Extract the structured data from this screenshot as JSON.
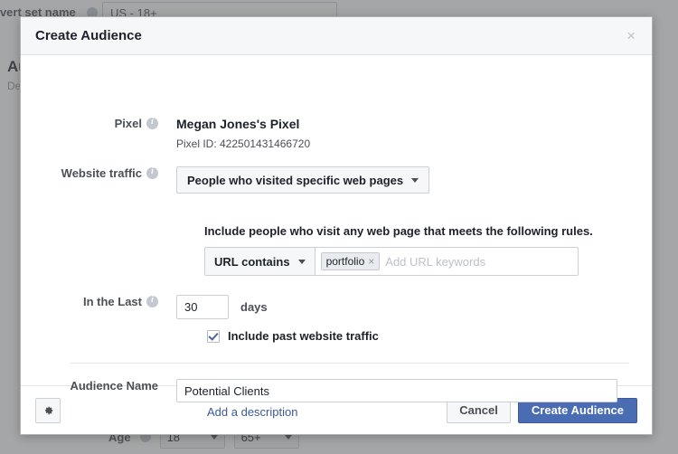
{
  "background": {
    "advert_set_label": "dvert set name",
    "advert_set_value": "US - 18+",
    "section_heading": "Au",
    "section_sub": "De",
    "age_label": "Age",
    "age_min": "18",
    "age_max": "65+"
  },
  "modal": {
    "title": "Create Audience",
    "close_label": "×",
    "pixel": {
      "label": "Pixel",
      "name": "Megan Jones's Pixel",
      "id_text": "Pixel ID: 422501431466720"
    },
    "website_traffic": {
      "label": "Website traffic",
      "selected": "People who visited specific web pages"
    },
    "rules": {
      "text": "Include people who visit any web page that meets the following rules.",
      "condition": "URL contains",
      "tokens": [
        "portfolio"
      ],
      "token_remove": "×",
      "placeholder": "Add URL keywords"
    },
    "retention": {
      "label": "In the Last",
      "days_value": "30",
      "days_unit": "days",
      "include_past_label": "Include past website traffic",
      "include_past_checked": true
    },
    "audience_name": {
      "label": "Audience Name",
      "value": "Potential Clients",
      "add_description": "Add a description"
    },
    "footer": {
      "settings_icon": "gear-icon",
      "cancel_label": "Cancel",
      "submit_label": "Create Audience"
    }
  },
  "colors": {
    "primary": "#4a6cb3",
    "link": "#3b5998",
    "header_bg": "#f6f7f9",
    "text": "#1d2129"
  }
}
